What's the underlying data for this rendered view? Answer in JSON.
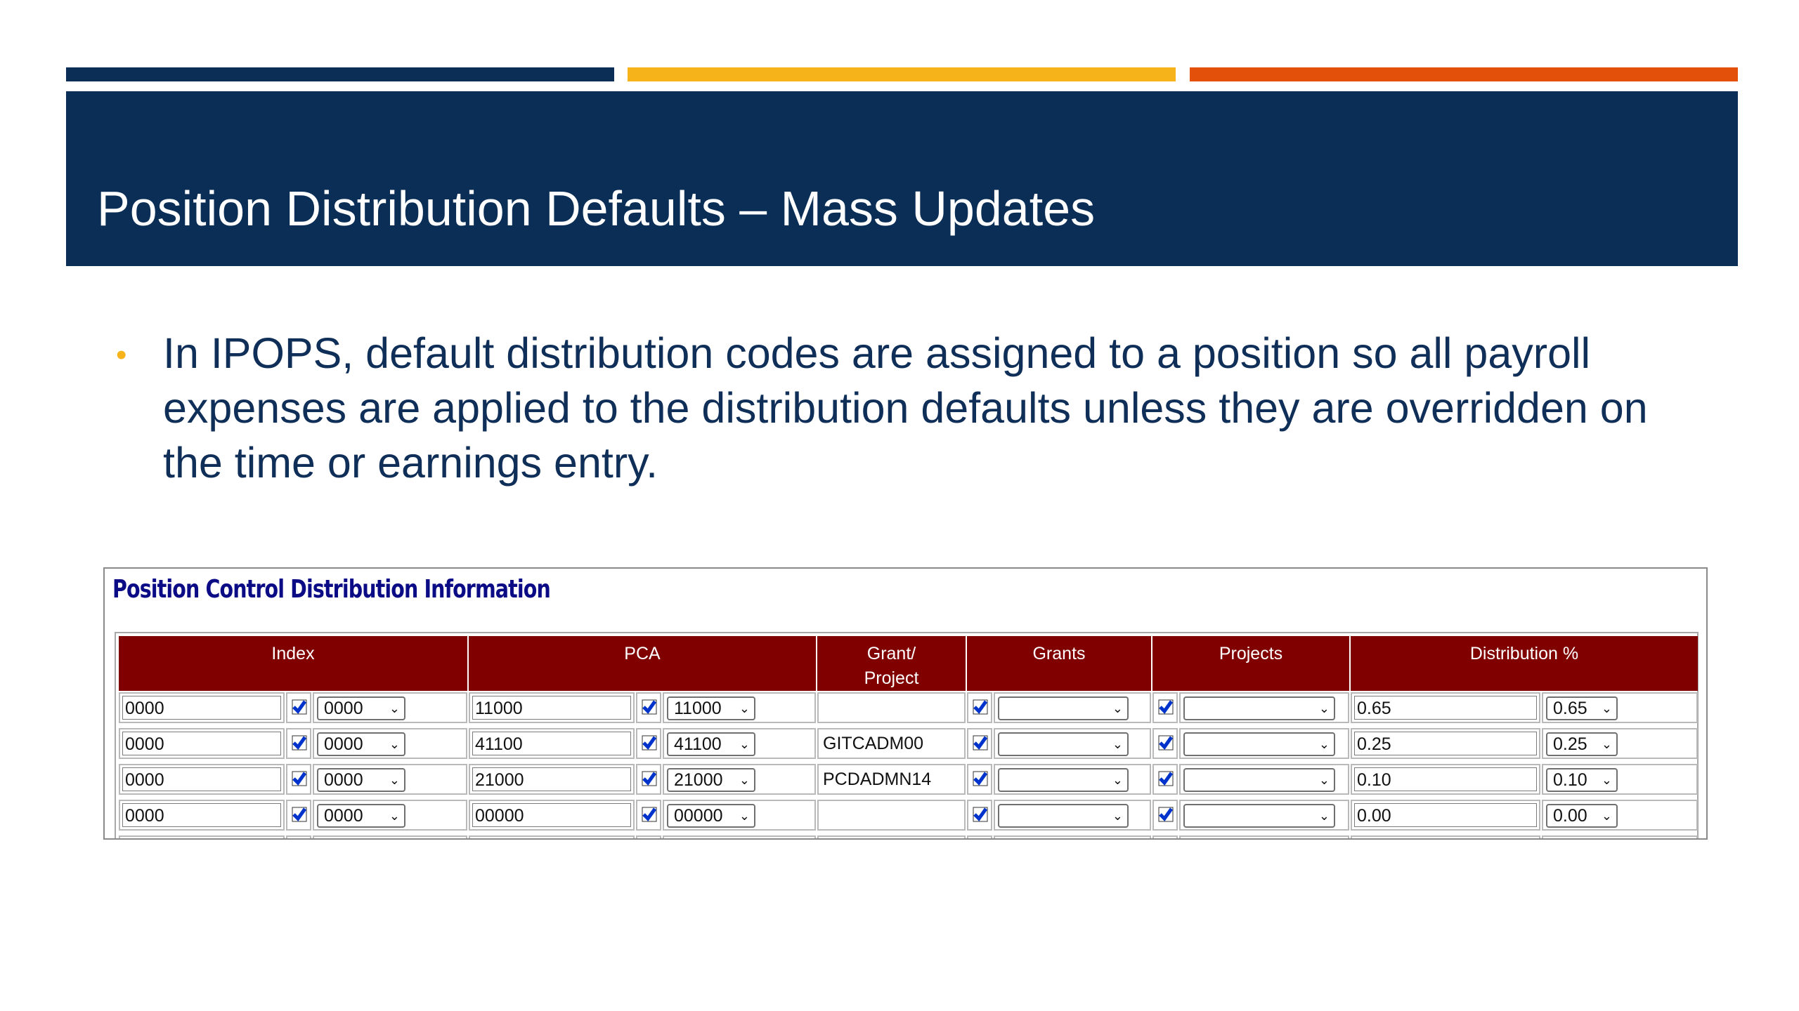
{
  "colors": {
    "bar_navy": "#0b2e56",
    "bar_gold": "#f6b41a",
    "bar_orange": "#e2500a",
    "header_bg": "#0b2e56",
    "bullet_color": "#f6b41a",
    "panel_title_color": "#0b0b86",
    "table_header_bg": "#800000",
    "checkbox_blue": "#0033cc"
  },
  "slide": {
    "title": "Position Distribution Defaults – Mass Updates",
    "bullet_text": "In IPOPS, default distribution codes are assigned to a position so all payroll expenses are applied to the distribution defaults unless they are overridden on the time or earnings entry."
  },
  "panel": {
    "title": "Position Control Distribution Information",
    "headers": {
      "index": "Index",
      "pca": "PCA",
      "grant_project_line1": "Grant/",
      "grant_project_line2": "Project",
      "grants": "Grants",
      "projects": "Projects",
      "distribution": "Distribution %"
    },
    "rows": [
      {
        "index": "0000",
        "index_select": "0000",
        "pca": "11000",
        "pca_select": "11000",
        "grant_project": "",
        "grants_select": "",
        "projects_select": "",
        "dist": "0.65",
        "dist_select": "0.65"
      },
      {
        "index": "0000",
        "index_select": "0000",
        "pca": "41100",
        "pca_select": "41100",
        "grant_project": "GITCADM00",
        "grants_select": "",
        "projects_select": "",
        "dist": "0.25",
        "dist_select": "0.25"
      },
      {
        "index": "0000",
        "index_select": "0000",
        "pca": "21000",
        "pca_select": "21000",
        "grant_project": "PCDADMN14",
        "grants_select": "",
        "projects_select": "",
        "dist": "0.10",
        "dist_select": "0.10"
      },
      {
        "index": "0000",
        "index_select": "0000",
        "pca": "00000",
        "pca_select": "00000",
        "grant_project": "",
        "grants_select": "",
        "projects_select": "",
        "dist": "0.00",
        "dist_select": "0.00"
      }
    ]
  }
}
